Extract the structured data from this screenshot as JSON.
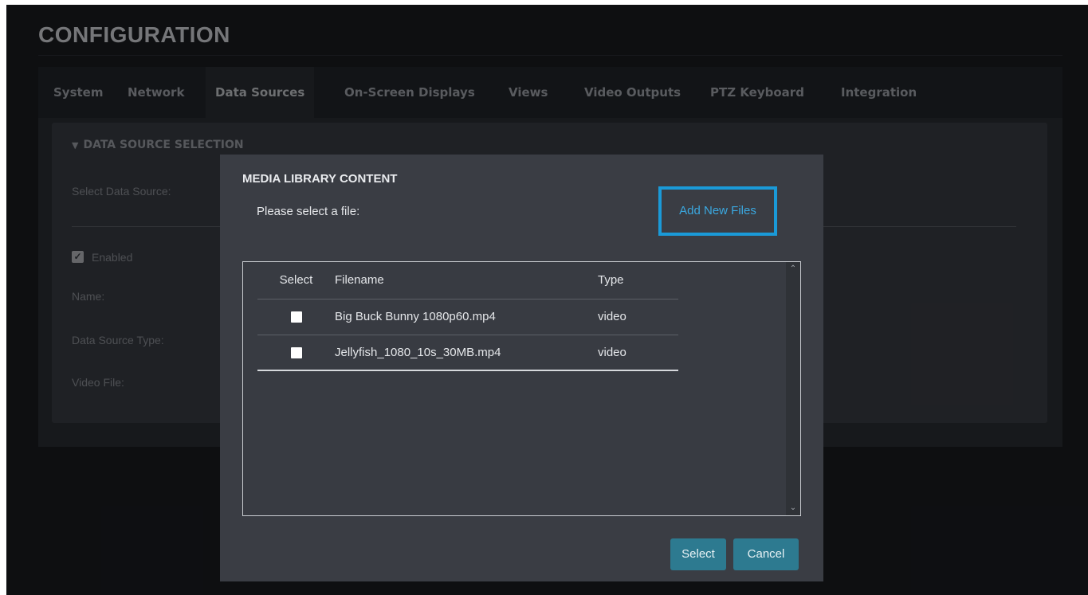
{
  "page": {
    "title": "CONFIGURATION"
  },
  "tabs": [
    {
      "label": "System"
    },
    {
      "label": "Network"
    },
    {
      "label": "Data Sources"
    },
    {
      "label": "On-Screen Displays"
    },
    {
      "label": "Views"
    },
    {
      "label": "Video Outputs"
    },
    {
      "label": "PTZ Keyboard"
    },
    {
      "label": "Integration"
    }
  ],
  "active_tab": "Data Sources",
  "section": {
    "header": "DATA SOURCE SELECTION",
    "select_label": "Select Data Source:",
    "enabled_label": "Enabled",
    "enabled_checked": true,
    "name_label": "Name:",
    "type_label": "Data Source Type:",
    "video_file_label": "Video File:"
  },
  "modal": {
    "title": "MEDIA LIBRARY CONTENT",
    "prompt": "Please select a file:",
    "add_files_label": "Add New Files",
    "columns": {
      "select": "Select",
      "filename": "Filename",
      "type": "Type"
    },
    "files": [
      {
        "filename": "Big Buck Bunny 1080p60.mp4",
        "type": "video",
        "selected": false
      },
      {
        "filename": "Jellyfish_1080_10s_30MB.mp4",
        "type": "video",
        "selected": false
      }
    ],
    "select_button": "Select",
    "cancel_button": "Cancel"
  },
  "colors": {
    "accent_blue": "#1a9ad8",
    "button_teal": "#2d7a90"
  }
}
